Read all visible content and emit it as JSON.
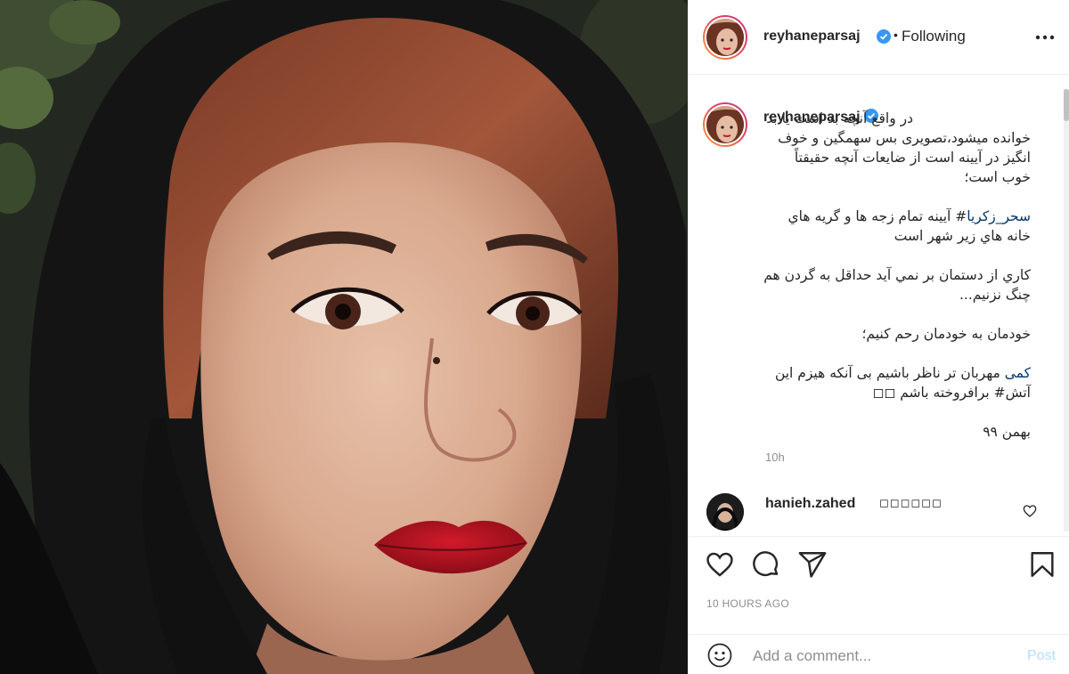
{
  "post": {
    "username": "reyhaneparsaj",
    "verified": true,
    "separator": "•",
    "follow_status": "Following",
    "more_icon": "more-horizontal-icon"
  },
  "caption": {
    "username": "reyhaneparsaj",
    "paragraphs": [
      "در واقع آنچه بد است یا بد خوانده میشود،تصویری بس سهمگین و خوف انگیز در آیینه است از ضایعات آنچه حقیقتاً خوب است؛",
      "سحر_زکریا# آیینه تمام زجه ها و گریه هاي خانه هاي زیر شهر است",
      "کاري از دستمان بر نمي آید حداقل به گردن هم چنگ نزنیم...",
      "خودمان به خودمان رحم کنیم؛",
      "کمی مهربان تر ناظر باشیم بی آنکه هیزم این آتش# برافروخته باشم ◻◻",
      "بهمن ۹۹"
    ],
    "hashtags": [
      "سحر_زکریا#",
      "کمی#"
    ],
    "age": "10h"
  },
  "comment": {
    "username": "hanieh.zahed",
    "text": "◻◻◻◻◻◻"
  },
  "actions": {
    "like_icon": "heart-icon",
    "comment_icon": "comment-icon",
    "share_icon": "send-icon",
    "save_icon": "bookmark-icon",
    "timestamp": "10 HOURS AGO"
  },
  "add_comment": {
    "placeholder": "Add a comment...",
    "post_label": "Post"
  },
  "colors": {
    "verified_blue": "#3897f0",
    "hashtag_link": "#00376b",
    "muted": "#8e8e8e",
    "post_disabled": "#b2dffc"
  }
}
